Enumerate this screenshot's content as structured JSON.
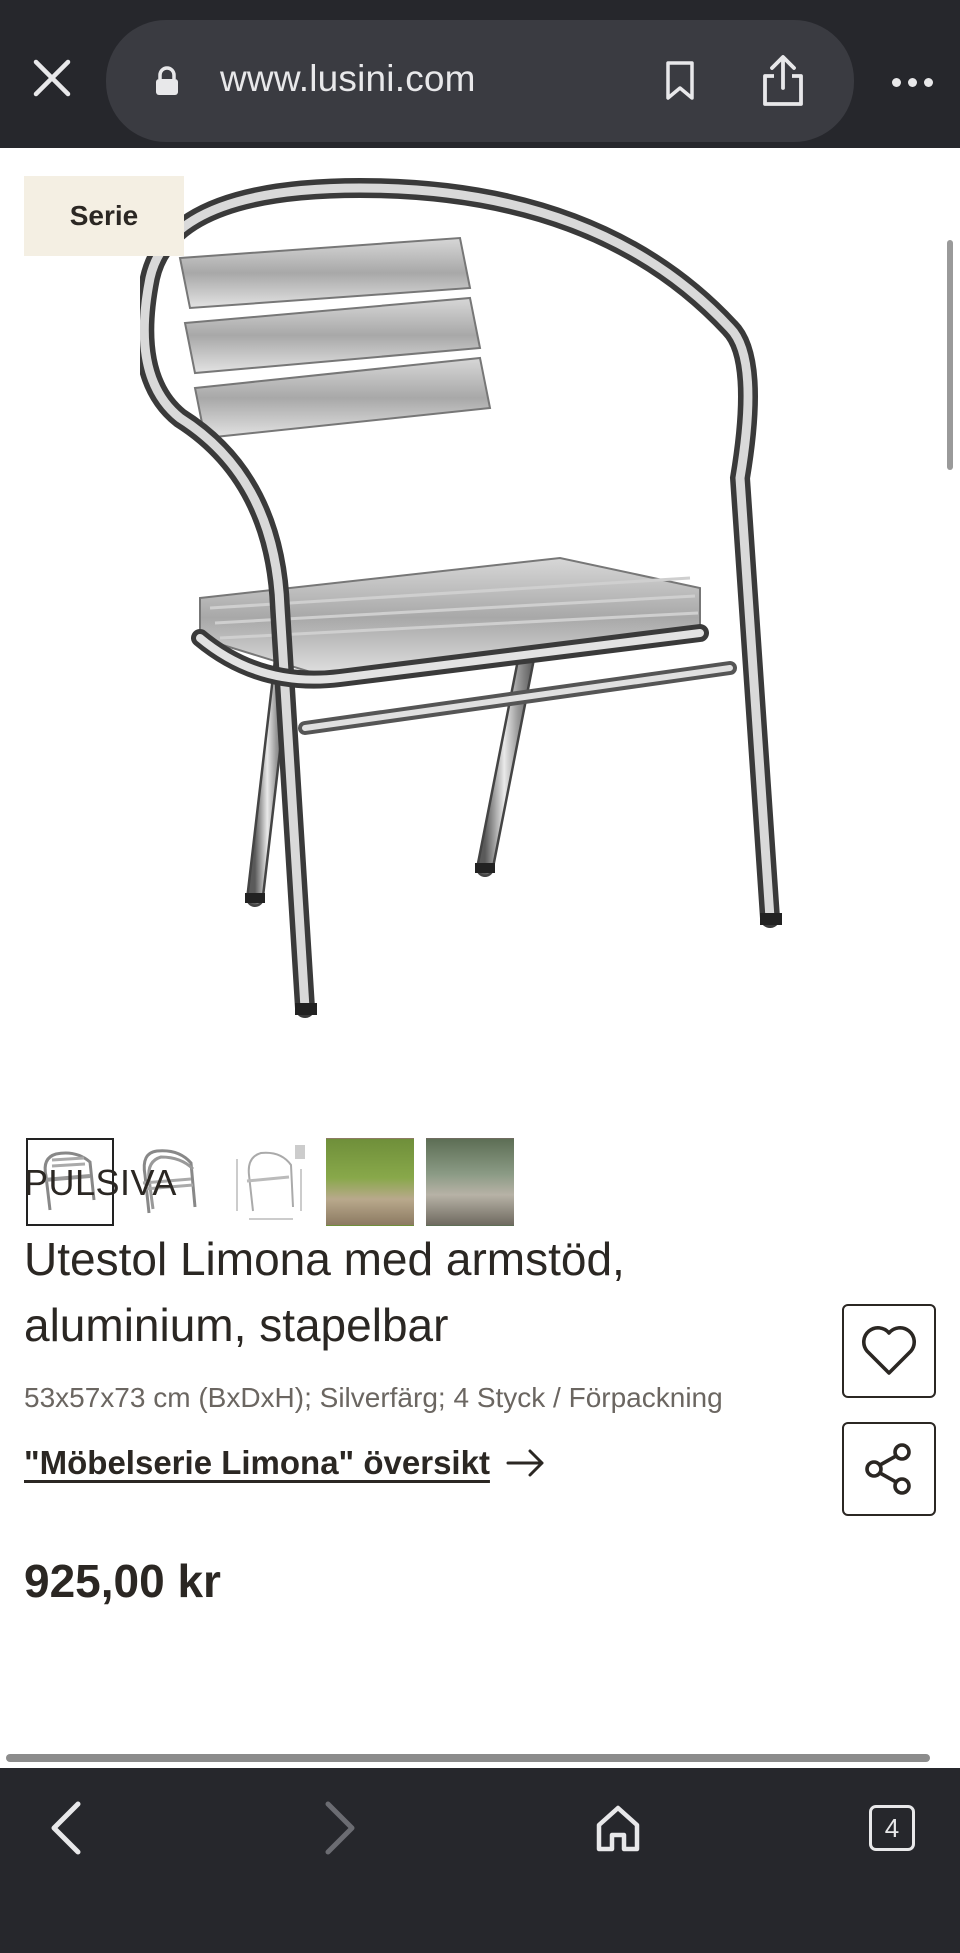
{
  "browser": {
    "url": "www.lusini.com",
    "tab_count": "4"
  },
  "product": {
    "badge": "Serie",
    "brand": "PULSIVA",
    "title_line1": "Utestol Limona med armstöd,",
    "title_line2": "aluminium, stapelbar",
    "specs": "53x57x73 cm (BxDxH); Silverfärg; 4 Styck / Förpackning",
    "series_link": "\"Möbelserie Limona\" översikt",
    "price": "925,00 kr",
    "thumbnails": [
      "chair-front",
      "chairs-stacked",
      "chair-dimensions",
      "terrace-photo-1",
      "terrace-photo-2"
    ]
  },
  "icons": {
    "close": "close-icon",
    "lock": "lock-icon",
    "bookmark": "bookmark-icon",
    "share": "share-icon",
    "more": "more-icon",
    "heart": "heart-icon",
    "back": "chevron-left-icon",
    "forward": "chevron-right-icon",
    "home": "home-icon",
    "tabs": "tabs-icon"
  }
}
